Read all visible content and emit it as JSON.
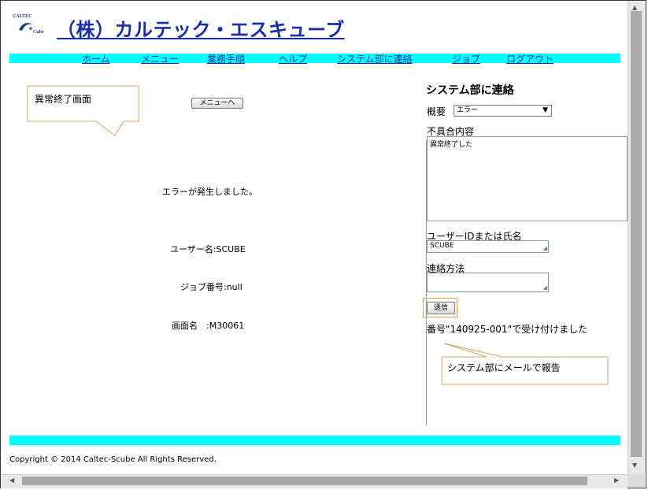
{
  "header": {
    "logo_top": "CALTEC",
    "logo_bottom": "Cube",
    "title": "（株）カルテック・エスキューブ"
  },
  "nav": {
    "items": [
      "ホーム",
      "メニュー",
      "業務手順",
      "ヘルプ",
      "システム部に連絡",
      "ジョブ",
      "ログアウト"
    ]
  },
  "main": {
    "callout_label": "異常終了画面",
    "menu_button": "メニューへ",
    "error_message": "エラーが発生しました。",
    "username_line": "ユーザー名:SCUBE",
    "job_line": "ジョブ番号:null",
    "screen_line": "画面名　:M30061"
  },
  "sidebar": {
    "title": "システム部に連絡",
    "summary_label": "概要",
    "summary_value": "エラー",
    "problem_label": "不具合内容",
    "problem_value": "異常終了した",
    "user_label": "ユーザーIDまたは氏名",
    "user_value": "SCUBE",
    "contact_label": "連絡方法",
    "contact_value": "",
    "send_button": "送信",
    "receipt_message": "番号\"140925-001\"で受け付けました",
    "callout_label": "システム部にメールで報告"
  },
  "footer": {
    "copyright": "Copyright © 2014 Caltec-Scube All Rights Reserved."
  },
  "colors": {
    "accent_bar": "#00ffff",
    "link": "#1a2ea8",
    "callout_border": "#e0a060"
  }
}
